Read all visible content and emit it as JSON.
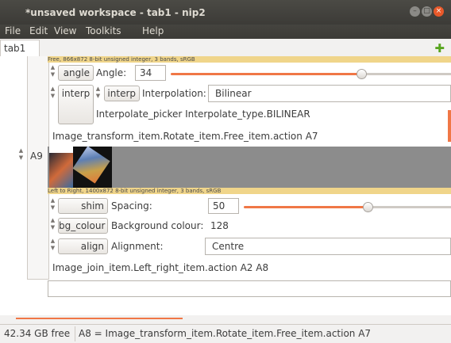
{
  "window": {
    "title": "*unsaved workspace - tab1 - nip2"
  },
  "menu": [
    "File",
    "Edit",
    "View",
    "Toolkits",
    "Help"
  ],
  "tabs": [
    {
      "label": "tab1"
    }
  ],
  "workspace": {
    "info_top": "Free, 866x872 8-bit unsigned integer, 3 bands, sRGB",
    "angle": {
      "button": "angle",
      "label": "Angle:",
      "value": "34",
      "slider_fraction": 0.64
    },
    "interp": {
      "outer_button": "interp",
      "inner_button": "interp",
      "label": "Interpolation:",
      "value": "Bilinear",
      "caption": "Interpolate_picker Interpolate_type.BILINEAR"
    },
    "rotate_caption": "Image_transform_item.Rotate_item.Free_item.action A7",
    "row_name": "A9",
    "info_bottom": "Left to Right, 1400x872 8-bit unsigned integer, 3 bands, sRGB",
    "shim": {
      "button": "shim",
      "label": "Spacing:",
      "value": "50",
      "slider_fraction": 0.5
    },
    "bg_colour": {
      "button": "bg_colour",
      "label": "Background colour:",
      "value": "128"
    },
    "align": {
      "button": "align",
      "label": "Alignment:",
      "value": "Centre"
    },
    "join_caption": "Image_join_item.Left_right_item.action A2 A8",
    "command_value": ""
  },
  "status": {
    "free": "42.34 GB free",
    "message": "A8 = Image_transform_item.Rotate_item.Free_item.action A7"
  },
  "colors": {
    "accent": "#f07746",
    "info_bg": "#f0d58a",
    "titlebar": "#3c3b37"
  }
}
